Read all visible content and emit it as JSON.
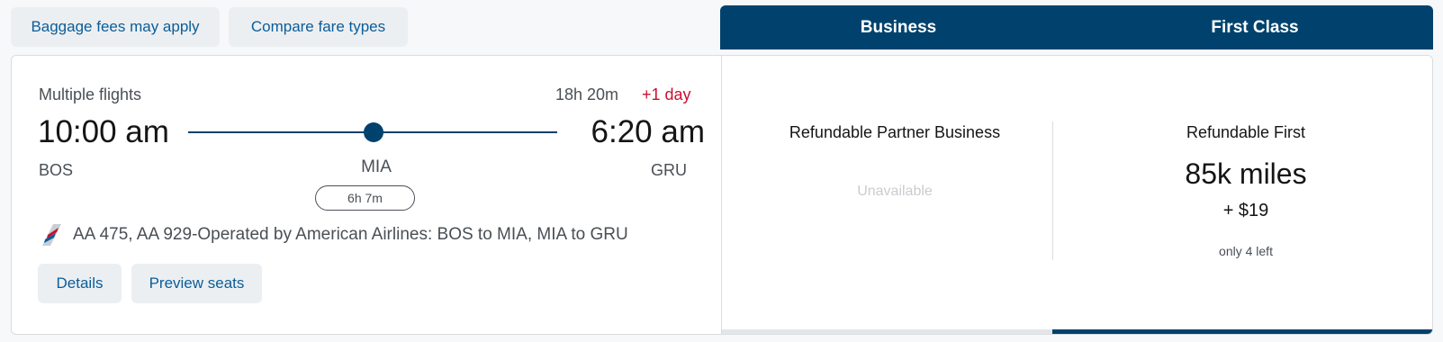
{
  "top_actions": {
    "baggage_label": "Baggage fees may apply",
    "compare_label": "Compare fare types"
  },
  "cabins": {
    "business": "Business",
    "first": "First Class"
  },
  "flight": {
    "type_label": "Multiple flights",
    "duration": "18h 20m",
    "day_offset": "+1 day",
    "depart_time": "10:00 am",
    "arrive_time": "6:20 am",
    "origin": "BOS",
    "stop": "MIA",
    "destination": "GRU",
    "layover": "6h 7m",
    "operated_by": "AA 475, AA 929-Operated by American Airlines: BOS to MIA, MIA to GRU",
    "airline_logo_icon": "american-airlines-tail-logo-icon",
    "details_label": "Details",
    "seats_label": "Preview seats"
  },
  "fares": {
    "business": {
      "title": "Refundable Partner Business",
      "status": "Unavailable"
    },
    "first": {
      "title": "Refundable First",
      "miles": "85k miles",
      "taxes": "+ $19",
      "seats_left": "only 4 left"
    }
  },
  "colors": {
    "brand_navy": "#00426d",
    "link_blue": "#0a5d9a",
    "alert_red": "#c8102e",
    "chip_bg": "#eceff1"
  }
}
